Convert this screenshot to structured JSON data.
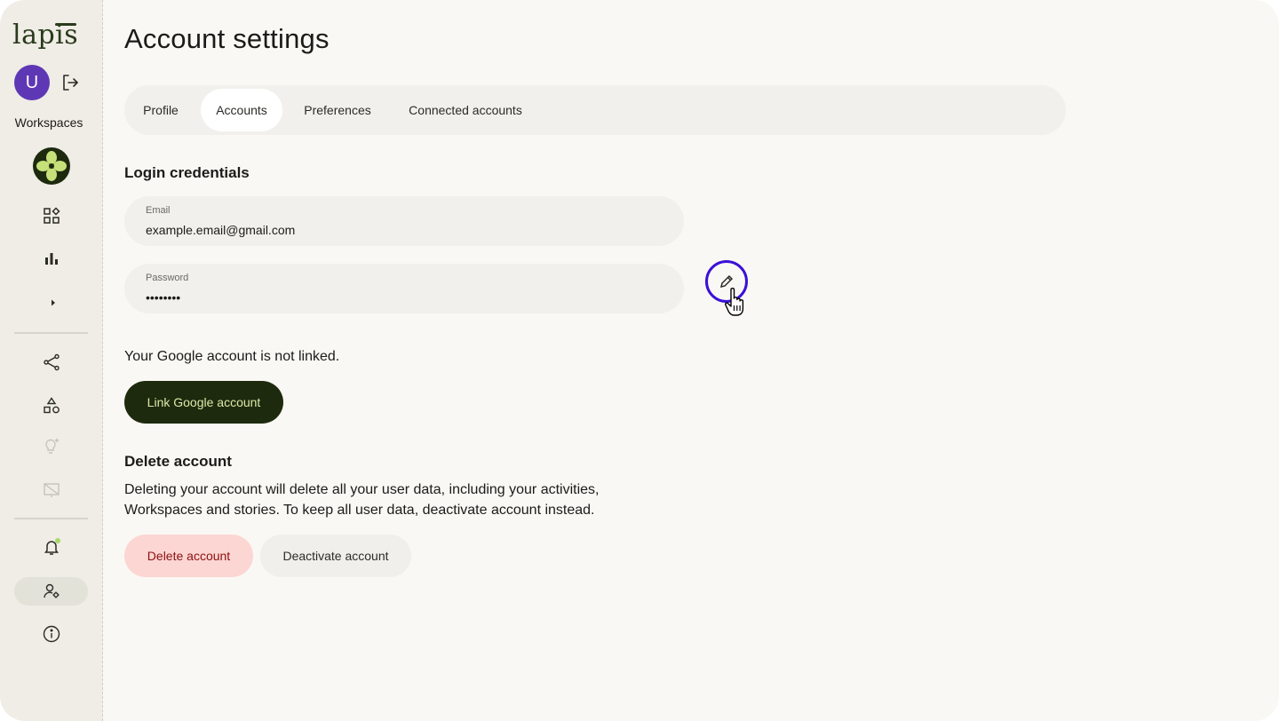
{
  "app": {
    "logo_text": "lapis"
  },
  "sidebar": {
    "avatar_initial": "U",
    "workspaces_label": "Workspaces",
    "items": [
      {
        "icon": "dashboard-icon"
      },
      {
        "icon": "bar-chart-icon"
      },
      {
        "icon": "chevron-right-icon"
      },
      {
        "icon": "share-icon"
      },
      {
        "icon": "shapes-icon"
      },
      {
        "icon": "lightbulb-sparkle-icon"
      },
      {
        "icon": "presentation-icon"
      },
      {
        "icon": "bell-icon"
      },
      {
        "icon": "user-settings-icon"
      },
      {
        "icon": "info-icon"
      }
    ]
  },
  "page": {
    "title": "Account settings"
  },
  "tabs": [
    {
      "label": "Profile"
    },
    {
      "label": "Accounts",
      "active": true
    },
    {
      "label": "Preferences"
    },
    {
      "label": "Connected accounts"
    }
  ],
  "login": {
    "title": "Login credentials",
    "email_label": "Email",
    "email_value": "example.email@gmail.com",
    "password_label": "Password",
    "password_value": "••••••••"
  },
  "google": {
    "status_text": "Your Google account is not linked.",
    "link_button": "Link Google account"
  },
  "delete": {
    "title": "Delete account",
    "description_line1": "Deleting your account will delete all your user data, including your activities,",
    "description_line2": "Workspaces and stories. To keep all user data, deactivate account instead.",
    "delete_button": "Delete account",
    "deactivate_button": "Deactivate account"
  },
  "colors": {
    "accent": "#1d2a0e",
    "accent_text": "#dde9a7",
    "avatar": "#5e37b5",
    "focus_ring": "#3b10d8",
    "danger_bg": "#fcd6d2",
    "danger_text": "#8a1010"
  }
}
